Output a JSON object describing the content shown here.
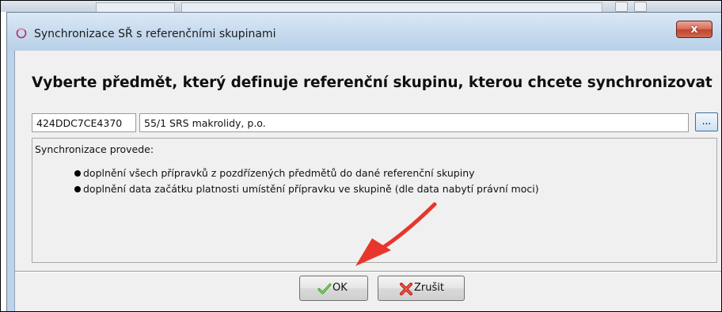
{
  "dialog": {
    "title": "Synchronizace SŘ s referenčními skupinami",
    "close_label": "x"
  },
  "main": {
    "heading": "Vyberte předmět, který definuje referenční skupinu, kterou chcete synchronizovat",
    "subject_code": "424DDC7CE4370",
    "subject_name": "55/1 SRS makrolidy, p.o.",
    "browse_label": "..."
  },
  "info": {
    "title": "Synchronizace provede:",
    "items": [
      "doplnění všech přípravků z pozdřízených předmětů do dané referenční skupiny",
      "doplnění data začátku platnosti umístění přípravku ve skupině (dle data nabytí právní moci)"
    ]
  },
  "buttons": {
    "ok_label": "OK",
    "cancel_label": "Zrušit"
  },
  "colors": {
    "title_bar": "#c6daee",
    "close_button": "#c2432d",
    "annotation_arrow": "#e8362c"
  },
  "icons": {
    "app": "ring-icon",
    "ok": "checkmark-icon",
    "cancel": "red-x-icon",
    "annotation": "red-arrow"
  }
}
